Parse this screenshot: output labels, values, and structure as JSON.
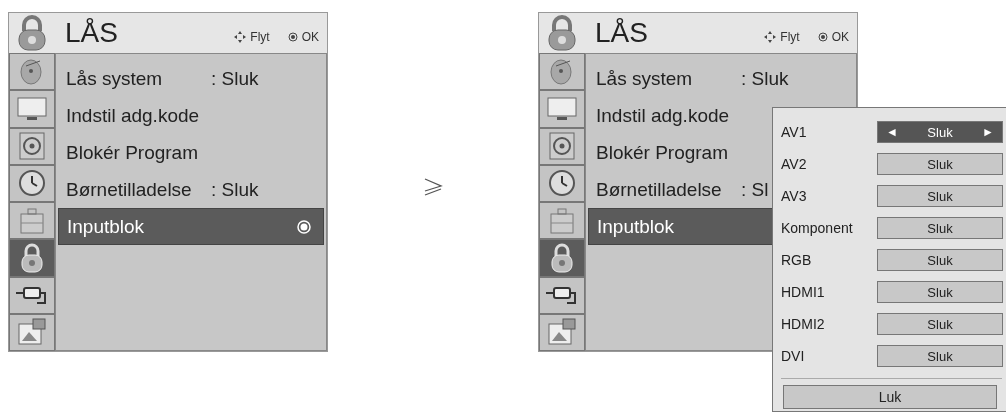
{
  "screens": [
    {
      "title": "LÅS",
      "hints": [
        {
          "kind": "move",
          "label": "Flyt"
        },
        {
          "kind": "ok",
          "label": "OK"
        }
      ],
      "sidebar": [
        {
          "kind": "satellite",
          "selected": false
        },
        {
          "kind": "monitor",
          "selected": false
        },
        {
          "kind": "speaker",
          "selected": false
        },
        {
          "kind": "clock",
          "selected": false
        },
        {
          "kind": "toolbox",
          "selected": false
        },
        {
          "kind": "lock",
          "selected": true
        },
        {
          "kind": "plug",
          "selected": false
        },
        {
          "kind": "photo",
          "selected": false
        }
      ],
      "items": [
        {
          "label": "Lås system",
          "value": ": Sluk",
          "selected": false,
          "ok_mark": false
        },
        {
          "label": "Indstil adg.kode",
          "selected": false,
          "ok_mark": false
        },
        {
          "label": "Blokér Program",
          "selected": false,
          "ok_mark": false
        },
        {
          "label": "Børnetilladelse",
          "value": ": Sluk",
          "selected": false,
          "ok_mark": false
        },
        {
          "label": "Inputblok",
          "selected": true,
          "ok_mark": true
        }
      ]
    },
    {
      "title": "LÅS",
      "hints": [
        {
          "kind": "move",
          "label": "Flyt"
        },
        {
          "kind": "ok",
          "label": "OK"
        }
      ],
      "sidebar": [
        {
          "kind": "satellite",
          "selected": false
        },
        {
          "kind": "monitor",
          "selected": false
        },
        {
          "kind": "speaker",
          "selected": false
        },
        {
          "kind": "clock",
          "selected": false
        },
        {
          "kind": "toolbox",
          "selected": false
        },
        {
          "kind": "lock",
          "selected": true
        },
        {
          "kind": "plug",
          "selected": false
        },
        {
          "kind": "photo",
          "selected": false
        }
      ],
      "items": [
        {
          "label": "Lås system",
          "value": ": Sluk",
          "selected": false,
          "ok_mark": false
        },
        {
          "label": "Indstil adg.kode",
          "selected": false,
          "ok_mark": false
        },
        {
          "label": "Blokér Program",
          "selected": false,
          "ok_mark": false
        },
        {
          "label": "Børnetilladelse",
          "value": ": Sl",
          "selected": false,
          "ok_mark": false
        },
        {
          "label": "Inputblok",
          "selected": true,
          "ok_mark": false
        }
      ],
      "popup": {
        "arrows": [
          "◄",
          "►"
        ],
        "rows": [
          {
            "label": "AV1",
            "value": "Sluk",
            "selected": true
          },
          {
            "label": "AV2",
            "value": "Sluk",
            "selected": false
          },
          {
            "label": "AV3",
            "value": "Sluk",
            "selected": false
          },
          {
            "label": "Komponent",
            "value": "Sluk",
            "selected": false
          },
          {
            "label": "RGB",
            "value": "Sluk",
            "selected": false
          },
          {
            "label": "HDMI1",
            "value": "Sluk",
            "selected": false
          },
          {
            "label": "HDMI2",
            "value": "Sluk",
            "selected": false
          },
          {
            "label": "DVI",
            "value": "Sluk",
            "selected": false
          }
        ],
        "close": "Luk"
      }
    }
  ]
}
